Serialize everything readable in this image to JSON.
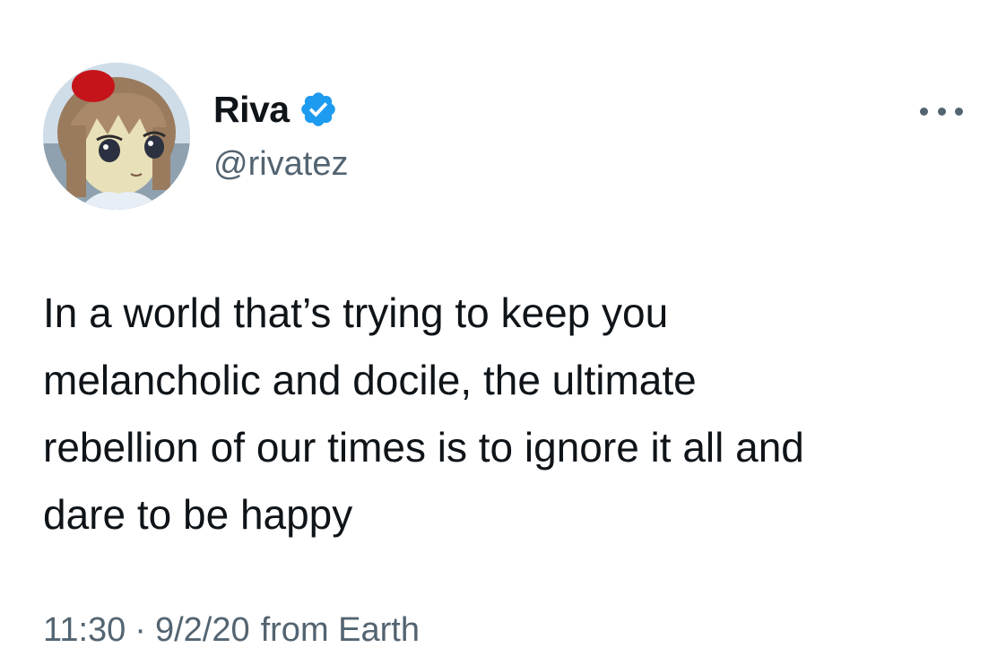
{
  "author": {
    "display_name": "Riva",
    "handle": "@rivatez",
    "verified_icon": "verified-badge-icon",
    "avatar_icon": "avatar-anime-girl"
  },
  "menu": {
    "icon": "more-horizontal-icon"
  },
  "tweet": {
    "text": "In a world that’s trying to keep you\nmelancholic and docile, the ultimate\nrebellion of our times is to ignore it all and\ndare to be happy"
  },
  "meta": {
    "time": "11:30",
    "separator": "·",
    "date": "9/2/20",
    "source": "from Earth"
  },
  "colors": {
    "text_primary": "#0f1419",
    "text_secondary": "#536471",
    "verified_blue": "#1d9bf0"
  }
}
